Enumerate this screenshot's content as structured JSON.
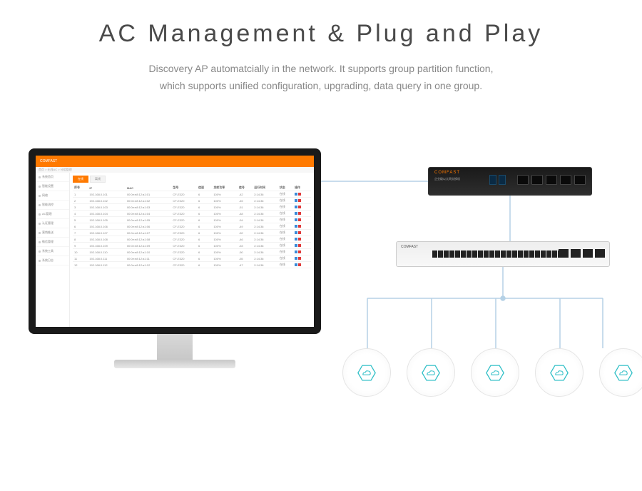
{
  "title": "AC Management & Plug and Play",
  "subtitle_line1": "Discovery AP automatcially in the network. It supports  group partition function,",
  "subtitle_line2": "which supports unified configuration, upgrading, data query in one group.",
  "colors": {
    "accent": "#ff7a00",
    "line": "#b5d1e6",
    "hex": "#2fbfc7"
  },
  "monitor": {
    "brand": "COMFAST",
    "crumb": "首页 > 无线AC > 分组管理",
    "sidebar": [
      "系统首页",
      "智能设置",
      "网络",
      "智能流控",
      "AC管理",
      "认证管理",
      "营销推送",
      "微信管理",
      "系统工具",
      "系统日志"
    ],
    "tabs": [
      "在线",
      "离线"
    ],
    "active_tab": 0,
    "table": {
      "headers": [
        "序号",
        "IP",
        "MAC",
        "型号",
        "信道",
        "发射功率",
        "信号",
        "运行时间",
        "状态",
        "操作"
      ],
      "rows": [
        [
          "1",
          "192.168.0.101",
          "00:0e:e8:12:a1:01",
          "CF-E320",
          "6",
          "100%",
          "-42",
          "2:14:36",
          "在线"
        ],
        [
          "2",
          "192.168.0.102",
          "00:0e:e8:12:a1:02",
          "CF-E320",
          "6",
          "100%",
          "-45",
          "2:14:36",
          "在线"
        ],
        [
          "3",
          "192.168.0.103",
          "00:0e:e8:12:a1:03",
          "CF-E320",
          "6",
          "100%",
          "-51",
          "2:14:36",
          "在线"
        ],
        [
          "4",
          "192.168.0.104",
          "00:0e:e8:12:a1:04",
          "CF-E320",
          "6",
          "100%",
          "-48",
          "2:14:36",
          "在线"
        ],
        [
          "5",
          "192.168.0.105",
          "00:0e:e8:12:a1:05",
          "CF-E320",
          "6",
          "100%",
          "-54",
          "2:14:36",
          "在线"
        ],
        [
          "6",
          "192.168.0.106",
          "00:0e:e8:12:a1:06",
          "CF-E320",
          "6",
          "100%",
          "-49",
          "2:14:36",
          "在线"
        ],
        [
          "7",
          "192.168.0.107",
          "00:0e:e8:12:a1:07",
          "CF-E320",
          "6",
          "100%",
          "-52",
          "2:14:36",
          "在线"
        ],
        [
          "8",
          "192.168.0.108",
          "00:0e:e8:12:a1:08",
          "CF-E320",
          "6",
          "100%",
          "-46",
          "2:14:36",
          "在线"
        ],
        [
          "9",
          "192.168.0.109",
          "00:0e:e8:12:a1:09",
          "CF-E320",
          "6",
          "100%",
          "-53",
          "2:14:36",
          "在线"
        ],
        [
          "10",
          "192.168.0.110",
          "00:0e:e8:12:a1:10",
          "CF-E320",
          "6",
          "100%",
          "-50",
          "2:14:36",
          "在线"
        ],
        [
          "11",
          "192.168.0.111",
          "00:0e:e8:12:a1:11",
          "CF-E320",
          "6",
          "100%",
          "-55",
          "2:14:36",
          "在线"
        ],
        [
          "12",
          "192.168.0.112",
          "00:0e:e8:12:a1:12",
          "CF-E320",
          "6",
          "100%",
          "-47",
          "2:14:36",
          "在线"
        ]
      ]
    }
  },
  "router": {
    "brand": "COMFAST",
    "label": "企业级以太网交换机",
    "wan_ports": 5,
    "blue_ports": 2
  },
  "switch": {
    "brand": "COMFAST",
    "ports": 24,
    "uplink_ports": 4
  },
  "ap_count": 5,
  "ap_icon": "cloud-icon"
}
